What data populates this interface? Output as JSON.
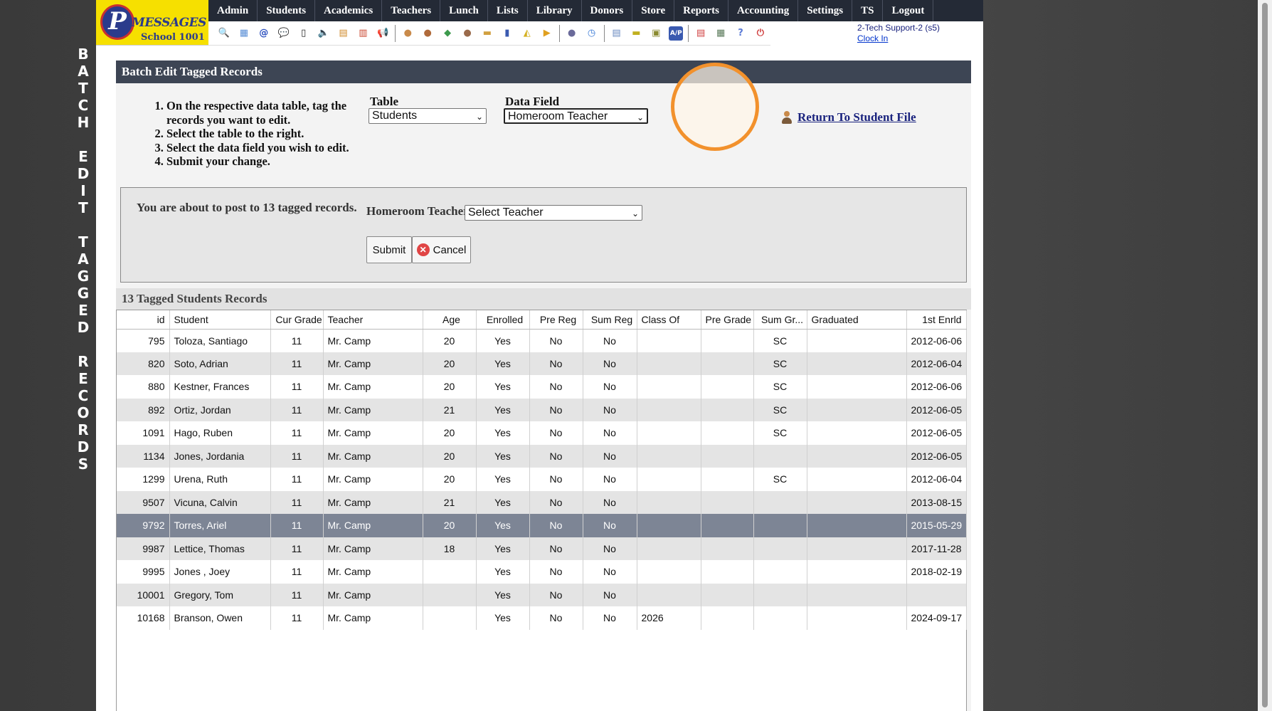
{
  "side_title": [
    "B",
    "A",
    "T",
    "C",
    "H",
    "",
    "E",
    "D",
    "I",
    "T",
    "",
    "T",
    "A",
    "G",
    "G",
    "E",
    "D",
    "",
    "R",
    "E",
    "C",
    "O",
    "R",
    "D",
    "S"
  ],
  "logo": {
    "initial": "P",
    "brand": "MESSAGES",
    "school": "School 1001"
  },
  "menu": [
    "Admin",
    "Students",
    "Academics",
    "Teachers",
    "Lunch",
    "Lists",
    "Library",
    "Donors",
    "Store",
    "Reports",
    "Accounting",
    "Settings",
    "TS",
    "Logout"
  ],
  "toolbar_icons": [
    {
      "name": "search-icon",
      "glyph": "🔍",
      "color": "#fff"
    },
    {
      "name": "calendar-grid-icon",
      "glyph": "▦",
      "color": "#5a8fd6"
    },
    {
      "name": "email-icon",
      "glyph": "@",
      "color": "#2b4fbf"
    },
    {
      "name": "chat-icon",
      "glyph": "💬",
      "color": "#3a9a3a"
    },
    {
      "name": "mobile-phone-icon",
      "glyph": "▯",
      "color": "#222"
    },
    {
      "name": "speaker-icon",
      "glyph": "🔈",
      "color": "#666"
    },
    {
      "name": "newsletter-icon",
      "glyph": "▤",
      "color": "#d08a2a"
    },
    {
      "name": "calendar-icon",
      "glyph": "▥",
      "color": "#c9452e"
    },
    {
      "name": "megaphone-icon",
      "glyph": "📢",
      "color": "#666"
    },
    {
      "sep": true
    },
    {
      "name": "student-icon",
      "glyph": "●",
      "color": "#c98a4a"
    },
    {
      "name": "teacher-icon",
      "glyph": "●",
      "color": "#b06a3a"
    },
    {
      "name": "money-icon",
      "glyph": "◆",
      "color": "#3d9a4d"
    },
    {
      "name": "parents-icon",
      "glyph": "●",
      "color": "#9a6a4a"
    },
    {
      "name": "lunch-icon",
      "glyph": "▬",
      "color": "#d1a040"
    },
    {
      "name": "book-icon",
      "glyph": "▮",
      "color": "#3a5ab0"
    },
    {
      "name": "bell-icon",
      "glyph": "◭",
      "color": "#d4b020"
    },
    {
      "name": "store-icon",
      "glyph": "▶",
      "color": "#e0a020"
    },
    {
      "sep": true
    },
    {
      "name": "staff-icon",
      "glyph": "●",
      "color": "#6a6a9a"
    },
    {
      "name": "clock-icon",
      "glyph": "◷",
      "color": "#3a7ad6"
    },
    {
      "sep": true
    },
    {
      "name": "report-icon",
      "glyph": "▤",
      "color": "#6a8ac0"
    },
    {
      "name": "card-icon",
      "glyph": "▬",
      "color": "#c0b020"
    },
    {
      "name": "printer-icon",
      "glyph": "▣",
      "color": "#8a8a30"
    },
    {
      "name": "ap-icon",
      "glyph": "A/P",
      "color": "#3a5ab0"
    },
    {
      "sep": true
    },
    {
      "name": "pdf-icon",
      "glyph": "▤",
      "color": "#d04040"
    },
    {
      "name": "cash-icon",
      "glyph": "▦",
      "color": "#5a7a5a"
    },
    {
      "name": "help-icon",
      "glyph": "?",
      "color": "#5a7ad6"
    },
    {
      "name": "power-icon",
      "glyph": "⏻",
      "color": "#d04040"
    }
  ],
  "user": {
    "name": "2-Tech Support-2 (s5)",
    "clock_in": "Clock In"
  },
  "panel": {
    "title": "Batch Edit Tagged Records",
    "instructions": [
      "On the respective data table, tag the records you want to edit.",
      "Select the table to the right.",
      "Select the data field you wish to edit.",
      "Submit your change."
    ],
    "table_label": "Table",
    "table_value": "Students",
    "field_label": "Data Field",
    "field_value": "Homeroom Teacher",
    "return_link": "Return To Student File"
  },
  "post": {
    "message": "You are about to post to 13 tagged records.",
    "field_label": "Homeroom Teacher",
    "select_value": "Select Teacher",
    "submit": "Submit",
    "cancel": "Cancel"
  },
  "grid": {
    "title": "13 Tagged Students Records",
    "columns": [
      "id",
      "Student",
      "Cur Grade",
      "Teacher",
      "Age",
      "Enrolled",
      "Pre Reg",
      "Sum Reg",
      "Class Of",
      "Pre Grade",
      "Sum Gr...",
      "Graduated",
      "1st Enrld"
    ],
    "selected_row": 8,
    "rows": [
      [
        "795",
        "Toloza, Santiago",
        "11",
        "Mr. Camp",
        "20",
        "Yes",
        "No",
        "No",
        "",
        "",
        "SC",
        "",
        "2012-06-06"
      ],
      [
        "820",
        "Soto, Adrian",
        "11",
        "Mr. Camp",
        "20",
        "Yes",
        "No",
        "No",
        "",
        "",
        "SC",
        "",
        "2012-06-04"
      ],
      [
        "880",
        "Kestner, Frances",
        "11",
        "Mr. Camp",
        "20",
        "Yes",
        "No",
        "No",
        "",
        "",
        "SC",
        "",
        "2012-06-06"
      ],
      [
        "892",
        "Ortiz, Jordan",
        "11",
        "Mr. Camp",
        "21",
        "Yes",
        "No",
        "No",
        "",
        "",
        "SC",
        "",
        "2012-06-05"
      ],
      [
        "1091",
        "Hago, Ruben",
        "11",
        "Mr. Camp",
        "20",
        "Yes",
        "No",
        "No",
        "",
        "",
        "SC",
        "",
        "2012-06-05"
      ],
      [
        "1134",
        "Jones, Jordania",
        "11",
        "Mr. Camp",
        "20",
        "Yes",
        "No",
        "No",
        "",
        "",
        "",
        "",
        "2012-06-05"
      ],
      [
        "1299",
        "Urena, Ruth",
        "11",
        "Mr. Camp",
        "20",
        "Yes",
        "No",
        "No",
        "",
        "",
        "SC",
        "",
        "2012-06-04"
      ],
      [
        "9507",
        "Vicuna, Calvin",
        "11",
        "Mr. Camp",
        "21",
        "Yes",
        "No",
        "No",
        "",
        "",
        "",
        "",
        "2013-08-15"
      ],
      [
        "9792",
        "Torres, Ariel",
        "11",
        "Mr. Camp",
        "20",
        "Yes",
        "No",
        "No",
        "",
        "",
        "",
        "",
        "2015-05-29"
      ],
      [
        "9987",
        "Lettice, Thomas",
        "11",
        "Mr. Camp",
        "18",
        "Yes",
        "No",
        "No",
        "",
        "",
        "",
        "",
        "2017-11-28"
      ],
      [
        "9995",
        "Jones , Joey",
        "11",
        "Mr. Camp",
        "",
        "Yes",
        "No",
        "No",
        "",
        "",
        "",
        "",
        "2018-02-19"
      ],
      [
        "10001",
        "Gregory, Tom",
        "11",
        "Mr. Camp",
        "",
        "Yes",
        "No",
        "No",
        "",
        "",
        "",
        "",
        ""
      ],
      [
        "10168",
        "Branson, Owen",
        "11",
        "Mr. Camp",
        "",
        "Yes",
        "No",
        "No",
        "2026",
        "",
        "",
        "",
        "2024-09-17"
      ]
    ]
  }
}
